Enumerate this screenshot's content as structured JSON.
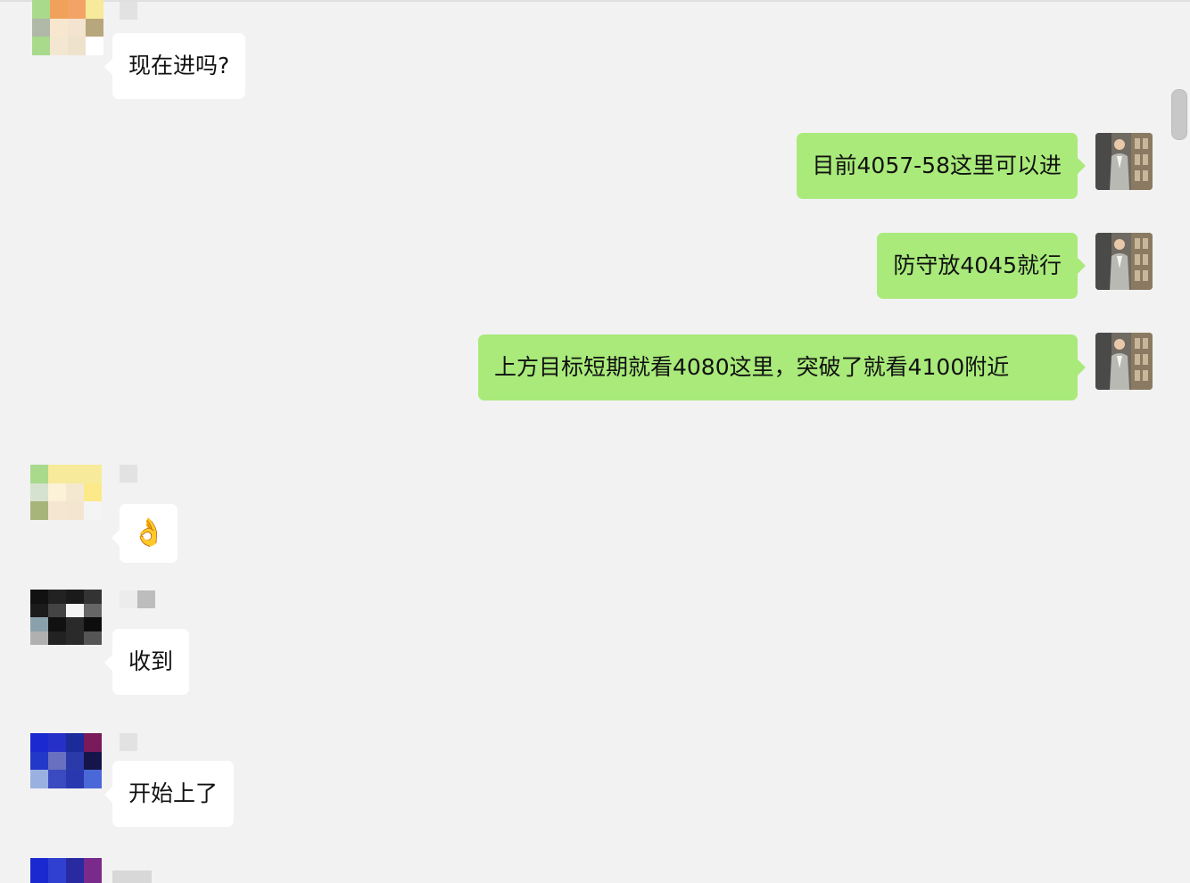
{
  "messages": [
    {
      "id": "m1",
      "direction": "in",
      "text": "现在进吗?"
    },
    {
      "id": "m2",
      "direction": "out",
      "text": "目前4057-58这里可以进"
    },
    {
      "id": "m3",
      "direction": "out",
      "text": "防守放4045就行"
    },
    {
      "id": "m4",
      "direction": "out",
      "text": "上方目标短期就看4080这里，突破了就看4100附近"
    },
    {
      "id": "m5",
      "direction": "in",
      "text": "👌"
    },
    {
      "id": "m6",
      "direction": "in",
      "text": "收到"
    },
    {
      "id": "m7",
      "direction": "in",
      "text": "开始上了"
    }
  ],
  "colors": {
    "background": "#f2f2f2",
    "incoming_bubble": "#ffffff",
    "outgoing_bubble": "#a9ea7a"
  },
  "icons": {
    "avatar_style": "pixelated-mosaic",
    "self_avatar": "photo-avatar"
  }
}
